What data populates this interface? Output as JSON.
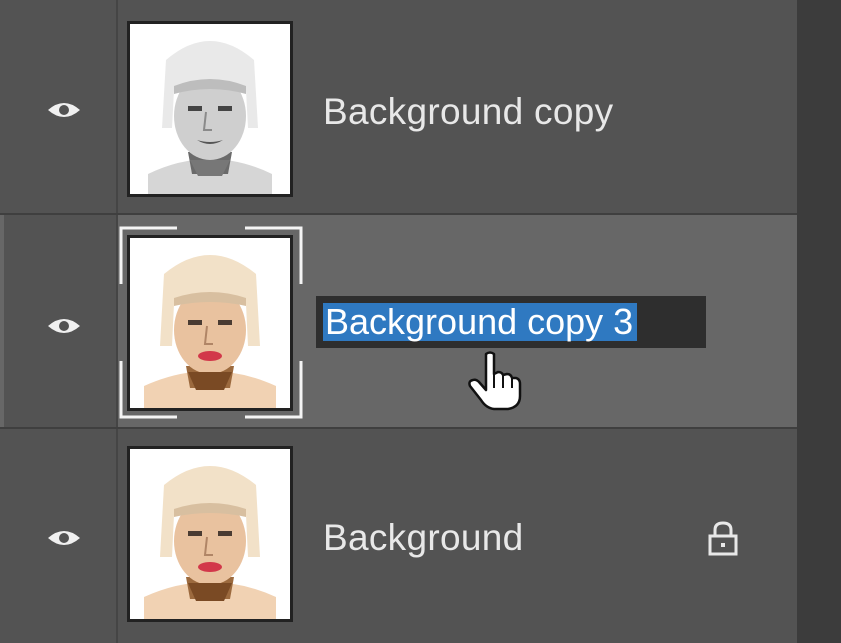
{
  "layers": [
    {
      "name": "Background copy",
      "visible": true,
      "locked": false,
      "selected": false,
      "thumbnail": "bw-portrait"
    },
    {
      "name": "Background copy 3",
      "visible": true,
      "locked": false,
      "selected": true,
      "renaming": true,
      "thumbnail": "color-portrait"
    },
    {
      "name": "Background",
      "visible": true,
      "locked": true,
      "selected": false,
      "thumbnail": "color-portrait"
    }
  ],
  "icons": {
    "visibility": "eye-icon",
    "lock": "lock-icon",
    "pointer": "hand-cursor-icon"
  },
  "colors": {
    "panel": "#535353",
    "selected_row": "#676767",
    "selection_highlight": "#2f79c1",
    "text": "#e8e8e8"
  }
}
